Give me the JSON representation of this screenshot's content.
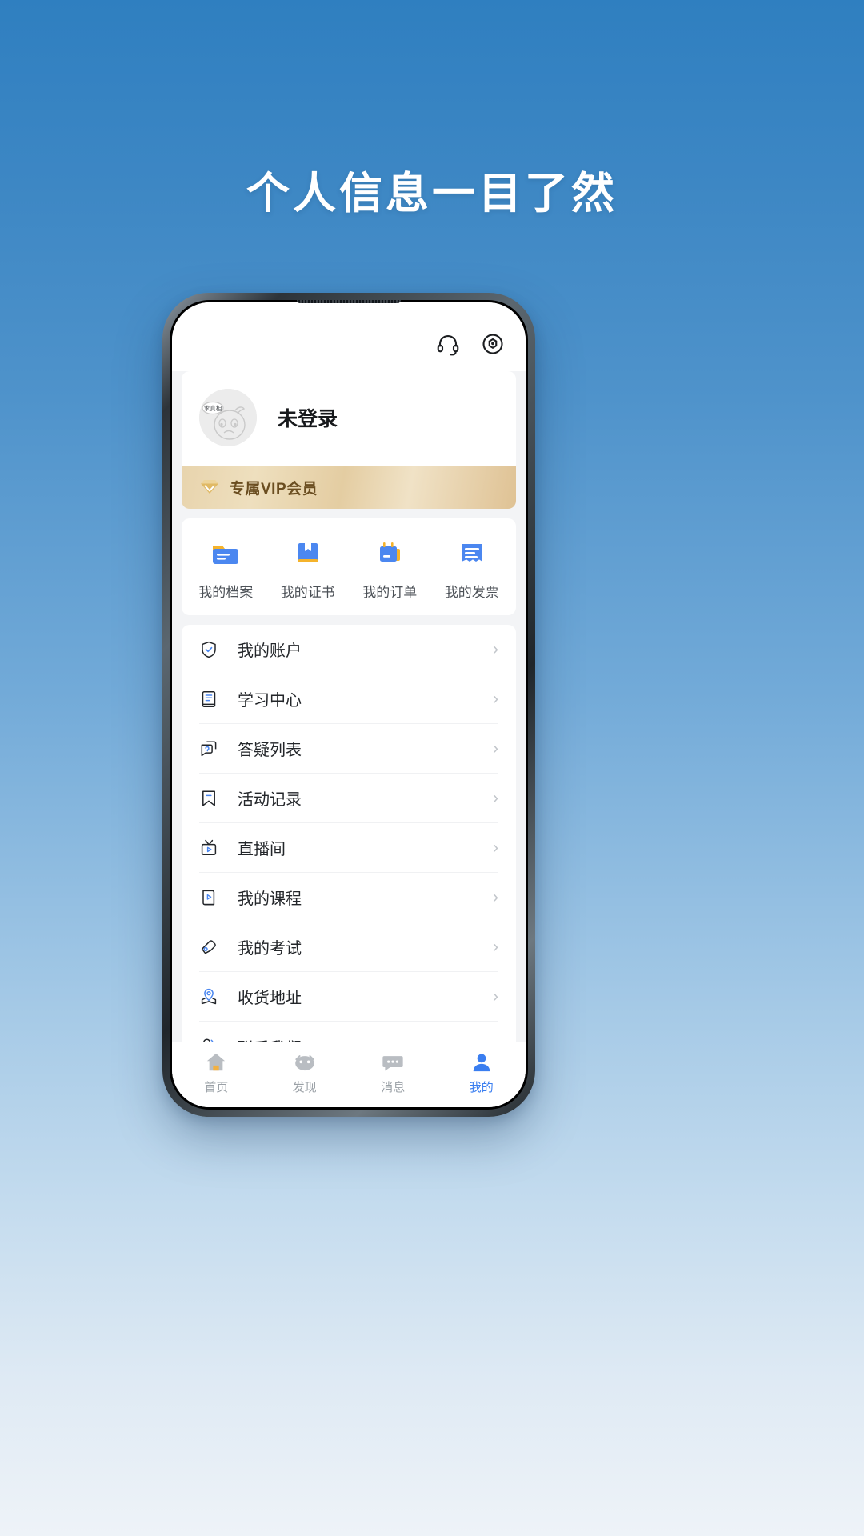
{
  "page": {
    "headline": "个人信息一目了然",
    "background_top_color": "#2f7fc0",
    "background_bottom_color": "#eef3f8"
  },
  "app": {
    "header": {
      "support_icon": "headset-icon",
      "scan_icon": "scan-icon"
    },
    "profile": {
      "username": "未登录",
      "avatar_caption": "求真相",
      "avatar_alt": "default-avatar"
    },
    "vip_banner": {
      "label": "专属VIP会员",
      "icon": "diamond-icon",
      "gradient_start": "#e8d4ad",
      "gradient_end": "#dfc294",
      "text_color": "#6b4e21"
    },
    "quick_actions": [
      {
        "label": "我的档案",
        "icon": "folder-icon"
      },
      {
        "label": "我的证书",
        "icon": "certificate-book-icon"
      },
      {
        "label": "我的订单",
        "icon": "order-clipboard-icon"
      },
      {
        "label": "我的发票",
        "icon": "invoice-icon"
      }
    ],
    "menu": [
      {
        "label": "我的账户",
        "icon": "shield-check-icon",
        "chevron": "›"
      },
      {
        "label": "学习中心",
        "icon": "book-lines-icon",
        "chevron": "›"
      },
      {
        "label": "答疑列表",
        "icon": "question-bubble-icon",
        "chevron": "›"
      },
      {
        "label": "活动记录",
        "icon": "bookmark-icon",
        "chevron": "›"
      },
      {
        "label": "直播间",
        "icon": "live-tv-icon",
        "chevron": "›"
      },
      {
        "label": "我的课程",
        "icon": "course-play-icon",
        "chevron": "›"
      },
      {
        "label": "我的考试",
        "icon": "exam-pen-icon",
        "chevron": "›"
      },
      {
        "label": "收货地址",
        "icon": "location-pin-icon",
        "chevron": "›"
      },
      {
        "label": "联系我们",
        "icon": "contact-user-icon",
        "chevron": "›"
      }
    ],
    "tabs": [
      {
        "label": "首页",
        "icon": "home-icon",
        "active": false
      },
      {
        "label": "发现",
        "icon": "discover-icon",
        "active": false
      },
      {
        "label": "消息",
        "icon": "message-icon",
        "active": false
      },
      {
        "label": "我的",
        "icon": "user-icon",
        "active": true
      }
    ],
    "colors": {
      "accent_blue": "#3a7ef0",
      "icon_blue": "#4b87f0",
      "icon_orange": "#f5b32b",
      "inactive_gray": "#9aa0a6"
    }
  }
}
